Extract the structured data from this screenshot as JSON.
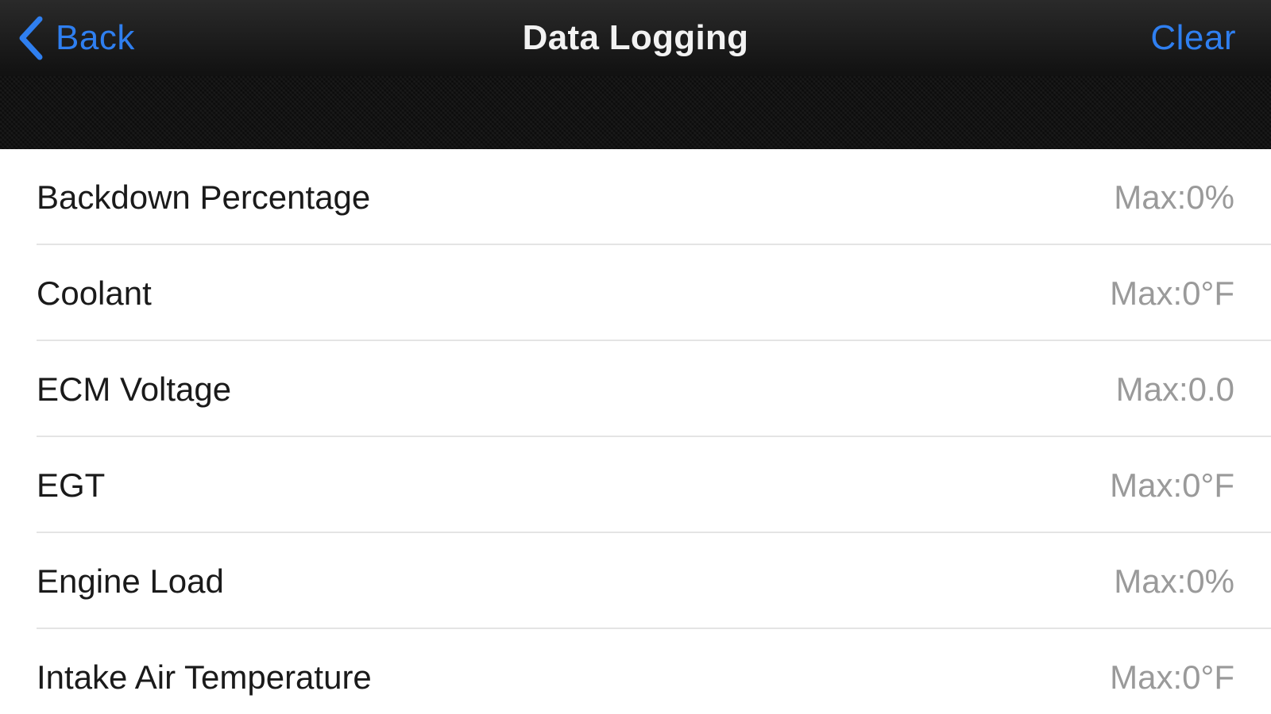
{
  "navbar": {
    "back_label": "Back",
    "title": "Data Logging",
    "clear_label": "Clear",
    "accent_color": "#2f7ff0"
  },
  "list": {
    "rows": [
      {
        "label": "Backdown Percentage",
        "value": "Max:0%"
      },
      {
        "label": "Coolant",
        "value": "Max:0°F"
      },
      {
        "label": "ECM Voltage",
        "value": "Max:0.0"
      },
      {
        "label": "EGT",
        "value": "Max:0°F"
      },
      {
        "label": "Engine Load",
        "value": "Max:0%"
      },
      {
        "label": "Intake Air Temperature",
        "value": "Max:0°F"
      }
    ]
  },
  "icons": {
    "back": "chevron-left-icon"
  }
}
